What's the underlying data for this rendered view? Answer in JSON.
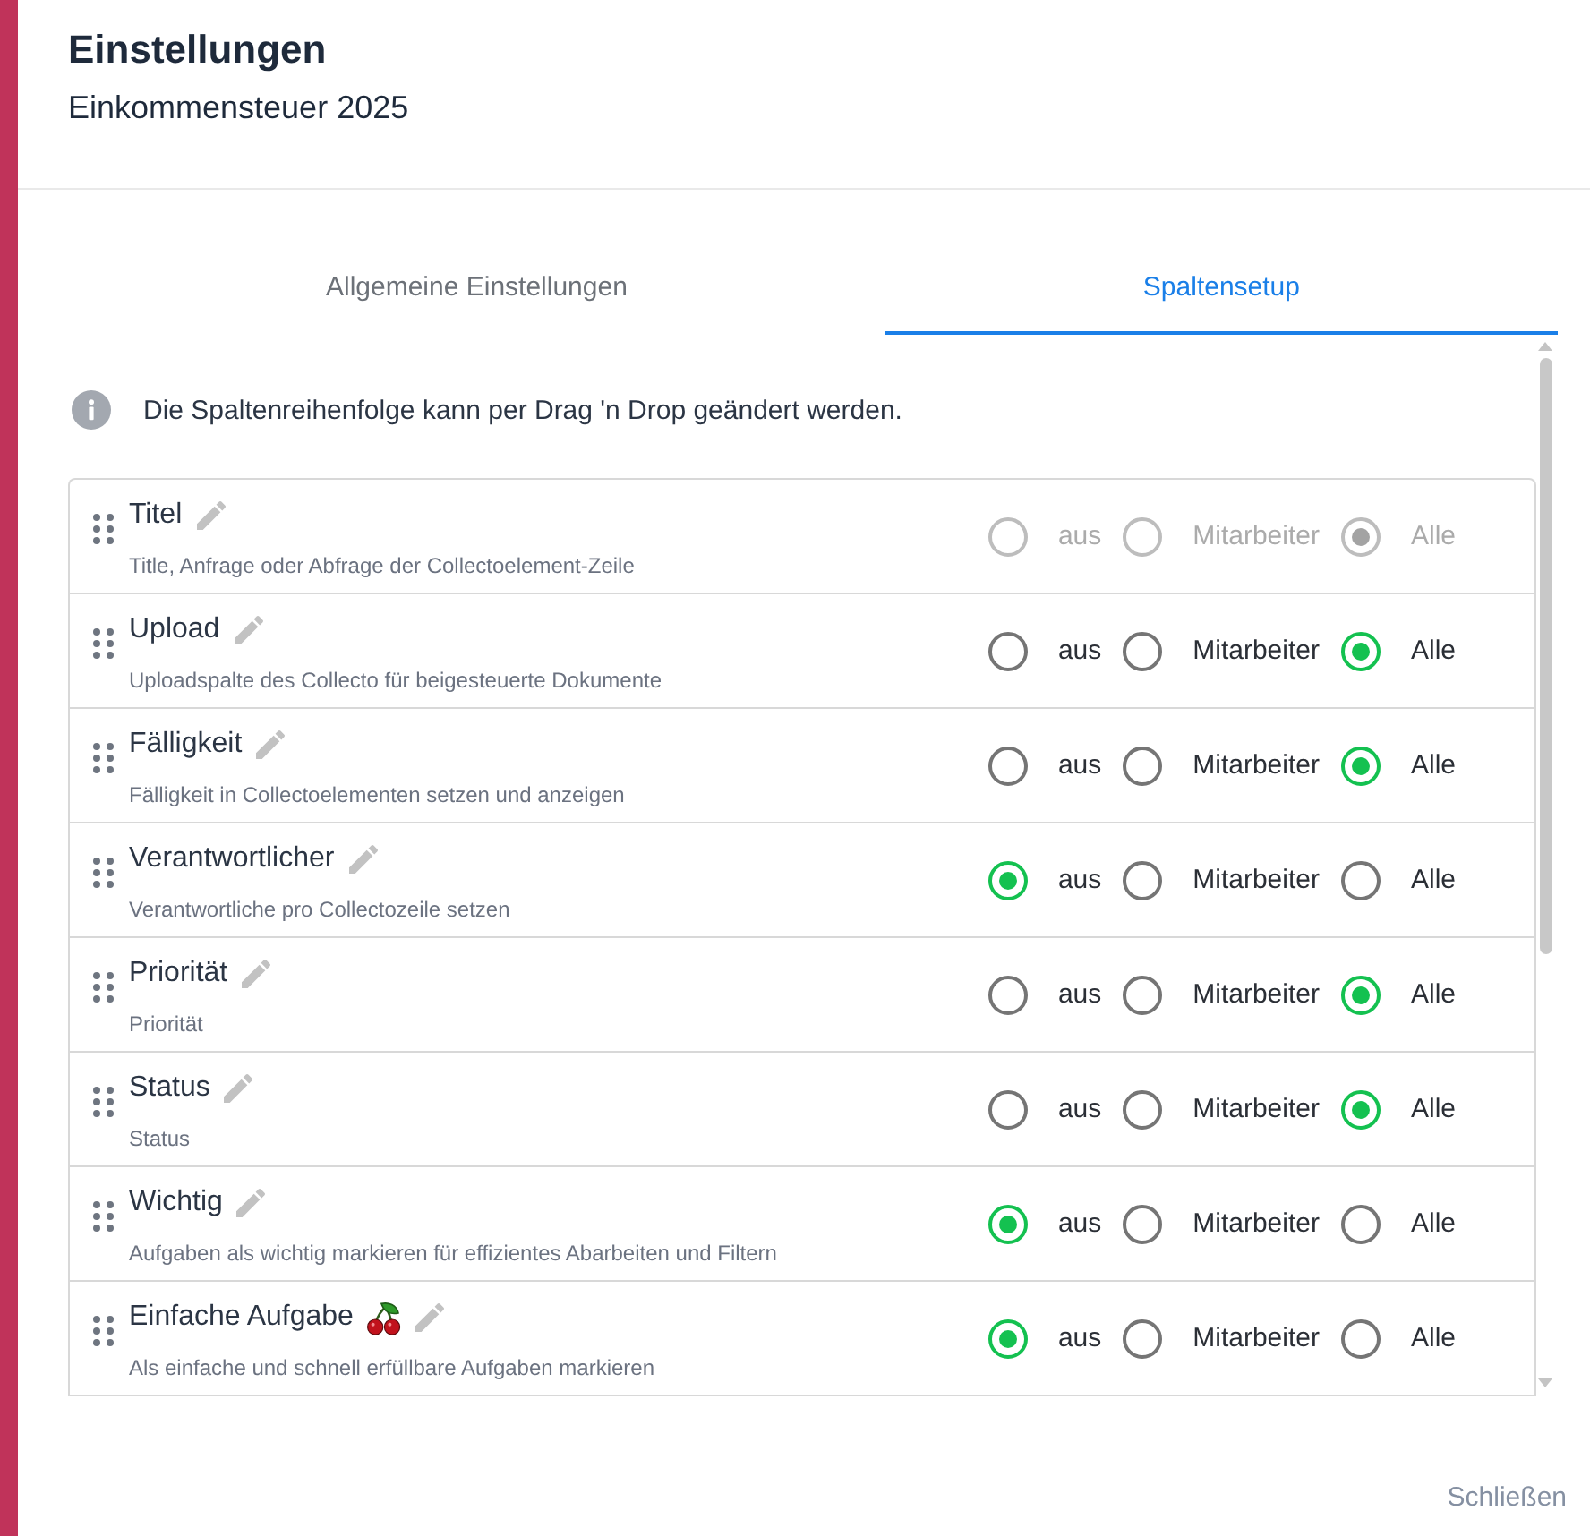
{
  "dialog": {
    "title": "Einstellungen",
    "subtitle": "Einkommensteuer 2025"
  },
  "tabs": [
    {
      "label": "Allgemeine Einstellungen",
      "selected": false
    },
    {
      "label": "Spaltensetup",
      "selected": true
    }
  ],
  "info": {
    "text": "Die Spaltenreihenfolge kann per Drag 'n Drop geändert werden."
  },
  "columns": [
    {
      "kind": "plain",
      "title": "Titel",
      "description": "Title, Anfrage oder Abfrage der Collectoelement-Zeile",
      "disabled": true,
      "options": [
        {
          "label": "aus",
          "selected": false
        },
        {
          "label": "Mitarbeiter",
          "selected": false
        },
        {
          "label": "Alle",
          "selected": true
        }
      ]
    },
    {
      "kind": "plain",
      "title": "Upload",
      "description": "Uploadspalte des Collecto für beigesteuerte Dokumente",
      "disabled": false,
      "options": [
        {
          "label": "aus",
          "selected": false
        },
        {
          "label": "Mitarbeiter",
          "selected": false
        },
        {
          "label": "Alle",
          "selected": true
        }
      ]
    },
    {
      "kind": "plain",
      "title": "Fälligkeit",
      "description": "Fälligkeit in Collectoelementen setzen und anzeigen",
      "disabled": false,
      "options": [
        {
          "label": "aus",
          "selected": false
        },
        {
          "label": "Mitarbeiter",
          "selected": false
        },
        {
          "label": "Alle",
          "selected": true
        }
      ]
    },
    {
      "kind": "plain",
      "title": "Verantwortlicher",
      "description": "Verantwortliche pro Collectozeile setzen",
      "disabled": false,
      "options": [
        {
          "label": "aus",
          "selected": true
        },
        {
          "label": "Mitarbeiter",
          "selected": false
        },
        {
          "label": "Alle",
          "selected": false
        }
      ]
    },
    {
      "kind": "plain",
      "title": "Priorität",
      "description": "Priorität",
      "disabled": false,
      "options": [
        {
          "label": "aus",
          "selected": false
        },
        {
          "label": "Mitarbeiter",
          "selected": false
        },
        {
          "label": "Alle",
          "selected": true
        }
      ]
    },
    {
      "kind": "plain",
      "title": "Status",
      "description": "Status",
      "disabled": false,
      "options": [
        {
          "label": "aus",
          "selected": false
        },
        {
          "label": "Mitarbeiter",
          "selected": false
        },
        {
          "label": "Alle",
          "selected": true
        }
      ]
    },
    {
      "kind": "plain",
      "title": "Wichtig",
      "description": "Aufgaben als wichtig markieren für effizientes Abarbeiten und Filtern",
      "disabled": false,
      "options": [
        {
          "label": "aus",
          "selected": true
        },
        {
          "label": "Mitarbeiter",
          "selected": false
        },
        {
          "label": "Alle",
          "selected": false
        }
      ]
    },
    {
      "kind": "emoji",
      "title": "Einfache Aufgabe",
      "description": "Als einfache und schnell erfüllbare Aufgaben markieren",
      "disabled": false,
      "options": [
        {
          "label": "aus",
          "selected": true
        },
        {
          "label": "Mitarbeiter",
          "selected": false
        },
        {
          "label": "Alle",
          "selected": false
        }
      ]
    }
  ],
  "footer": {
    "close_button": "Schließen"
  }
}
